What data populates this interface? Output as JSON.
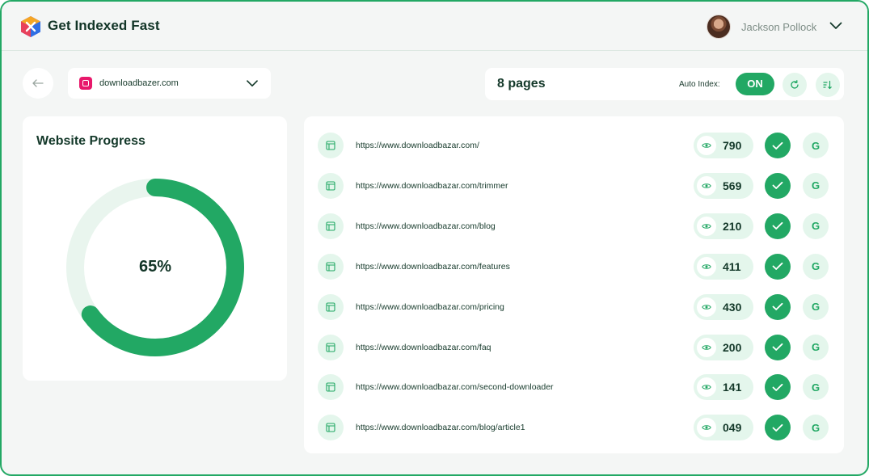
{
  "app": {
    "title": "Get Indexed Fast",
    "accent_color": "#22a864",
    "accent_light": "#e4f6ec"
  },
  "user": {
    "name": "Jackson Pollock",
    "menu_icon": "chevron-down-icon"
  },
  "toolbar": {
    "site": "downloadbazer.com",
    "pages_label": "8 pages",
    "auto_index_label": "Auto Index:",
    "auto_index_state": "ON"
  },
  "progress": {
    "title": "Website Progress",
    "percent": 65,
    "percent_label": "65%"
  },
  "pages": [
    {
      "url": "https://www.downloadbazar.com/",
      "views": "790"
    },
    {
      "url": "https://www.downloadbazar.com/trimmer",
      "views": "569"
    },
    {
      "url": "https://www.downloadbazar.com/blog",
      "views": "210"
    },
    {
      "url": "https://www.downloadbazar.com/features",
      "views": "411"
    },
    {
      "url": "https://www.downloadbazar.com/pricing",
      "views": "430"
    },
    {
      "url": "https://www.downloadbazar.com/faq",
      "views": "200"
    },
    {
      "url": "https://www.downloadbazar.com/second-downloader",
      "views": "141"
    },
    {
      "url": "https://www.downloadbazar.com/blog/article1",
      "views": "049"
    }
  ],
  "google_letter": "G"
}
